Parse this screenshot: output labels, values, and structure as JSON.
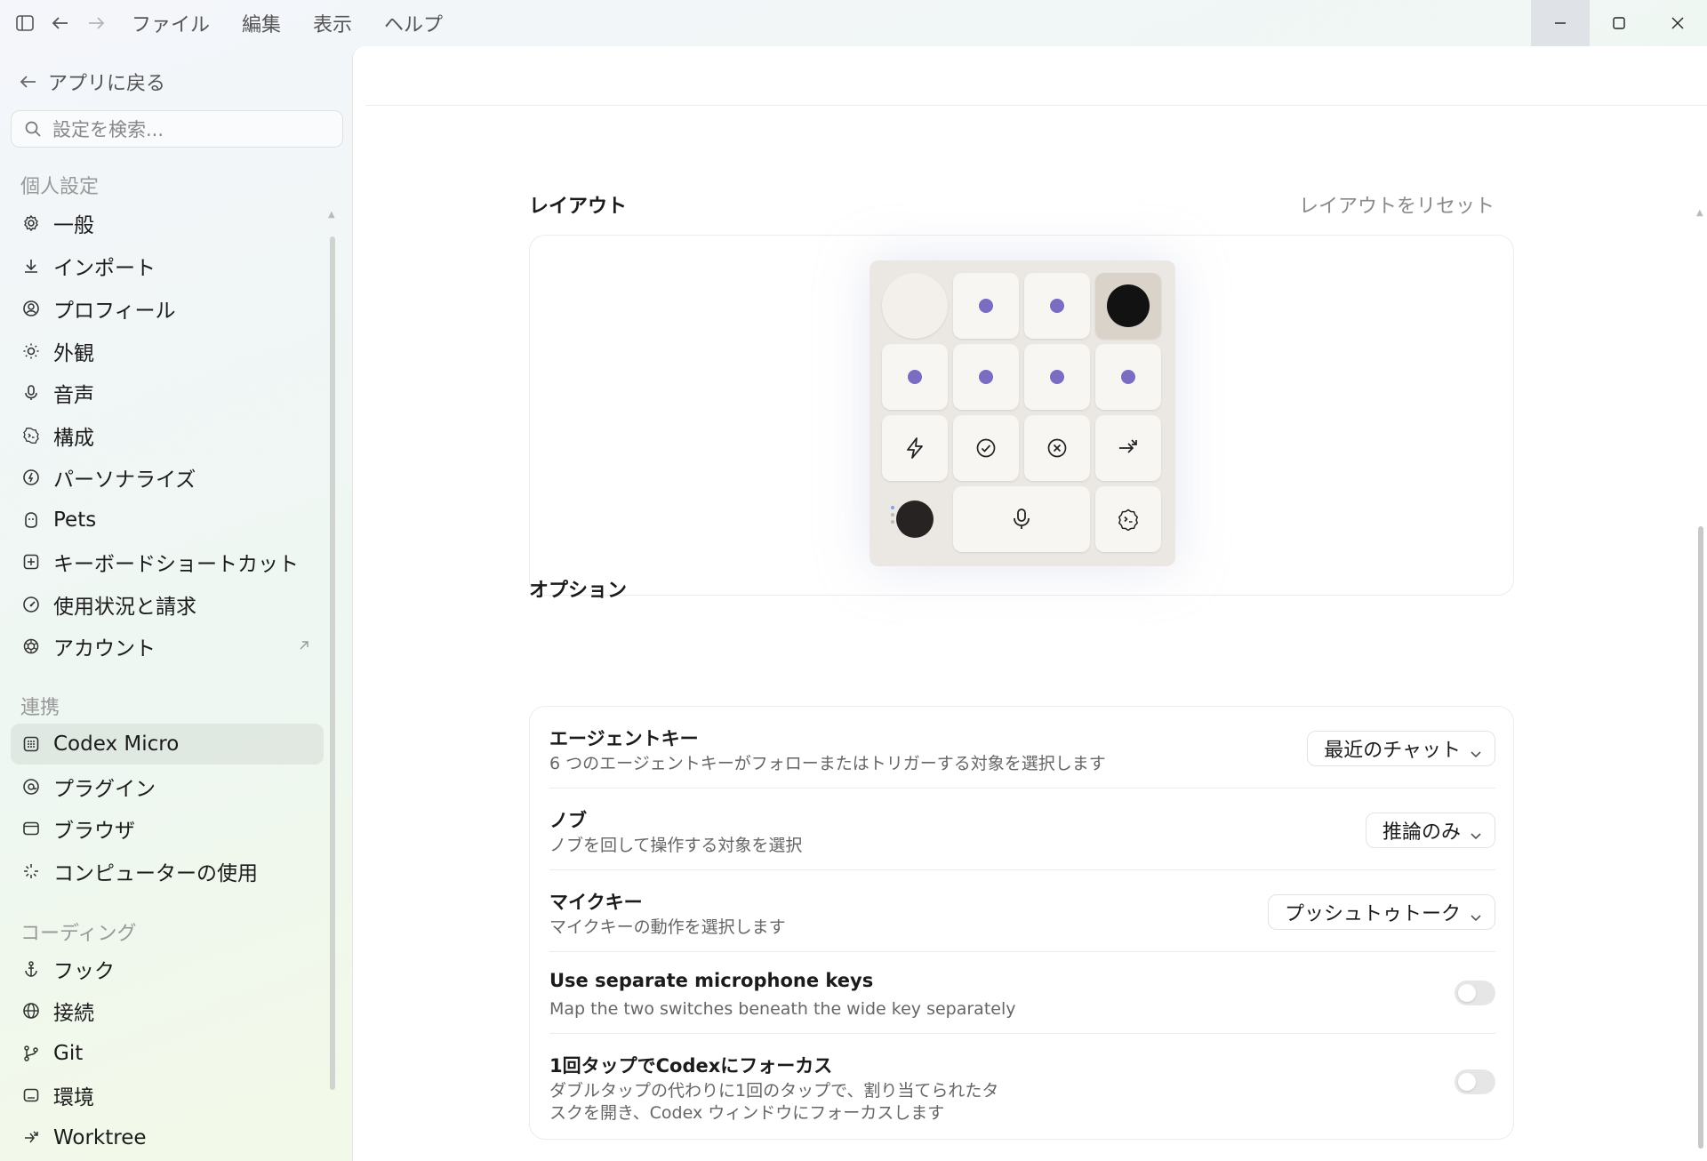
{
  "menu": [
    "ファイル",
    "編集",
    "表示",
    "ヘルプ"
  ],
  "sidebar": {
    "back_label": "アプリに戻る",
    "search_placeholder": "設定を検索...",
    "sections": [
      {
        "heading": "個人設定",
        "items": [
          {
            "label": "一般",
            "icon": "gear-icon"
          },
          {
            "label": "インポート",
            "icon": "download-icon"
          },
          {
            "label": "プロフィール",
            "icon": "profile-icon"
          },
          {
            "label": "外観",
            "icon": "sun-icon"
          },
          {
            "label": "音声",
            "icon": "microphone-icon"
          },
          {
            "label": "構成",
            "icon": "terminal-badge-icon"
          },
          {
            "label": "パーソナライズ",
            "icon": "personalize-icon"
          },
          {
            "label": "Pets",
            "icon": "pet-icon"
          },
          {
            "label": "キーボードショートカット",
            "icon": "keyboard-shortcut-icon"
          },
          {
            "label": "使用状況と請求",
            "icon": "gauge-icon"
          },
          {
            "label": "アカウント",
            "icon": "openai-icon",
            "external": true
          }
        ]
      },
      {
        "heading": "連携",
        "items": [
          {
            "label": "Codex Micro",
            "icon": "keypad-icon",
            "active": true
          },
          {
            "label": "プラグイン",
            "icon": "plugin-icon"
          },
          {
            "label": "ブラウザ",
            "icon": "browser-icon"
          },
          {
            "label": "コンピューターの使用",
            "icon": "sparkle-icon"
          }
        ]
      },
      {
        "heading": "コーディング",
        "items": [
          {
            "label": "フック",
            "icon": "anchor-icon"
          },
          {
            "label": "接続",
            "icon": "globe-icon"
          },
          {
            "label": "Git",
            "icon": "git-branch-icon"
          },
          {
            "label": "環境",
            "icon": "environment-icon"
          },
          {
            "label": "Worktree",
            "icon": "worktree-icon"
          }
        ]
      }
    ]
  },
  "layout": {
    "heading": "レイアウト",
    "reset_label": "レイアウトをリセット"
  },
  "options": {
    "heading": "オプション",
    "rows": [
      {
        "title": "エージェントキー",
        "desc": "6 つのエージェントキーがフォローまたはトリガーする対象を選択します",
        "control": "dropdown",
        "value": "最近のチャット"
      },
      {
        "title": "ノブ",
        "desc": "ノブを回して操作する対象を選択",
        "control": "dropdown",
        "value": "推論のみ"
      },
      {
        "title": "マイクキー",
        "desc": "マイクキーの動作を選択します",
        "control": "dropdown",
        "value": "プッシュトゥトーク"
      },
      {
        "title": "Use separate microphone keys",
        "desc": "Map the two switches beneath the wide key separately",
        "control": "toggle",
        "value": "off"
      },
      {
        "title": "1回タップでCodexにフォーカス",
        "desc": "ダブルタップの代わりに1回のタップで、割り当てられたタスクを開き、Codex ウィンドウにフォーカスします",
        "control": "toggle",
        "value": "off"
      }
    ]
  },
  "colors": {
    "key_dot": "#7a6cc0",
    "knob": "#121212",
    "device_body": "#ebe8e3"
  }
}
